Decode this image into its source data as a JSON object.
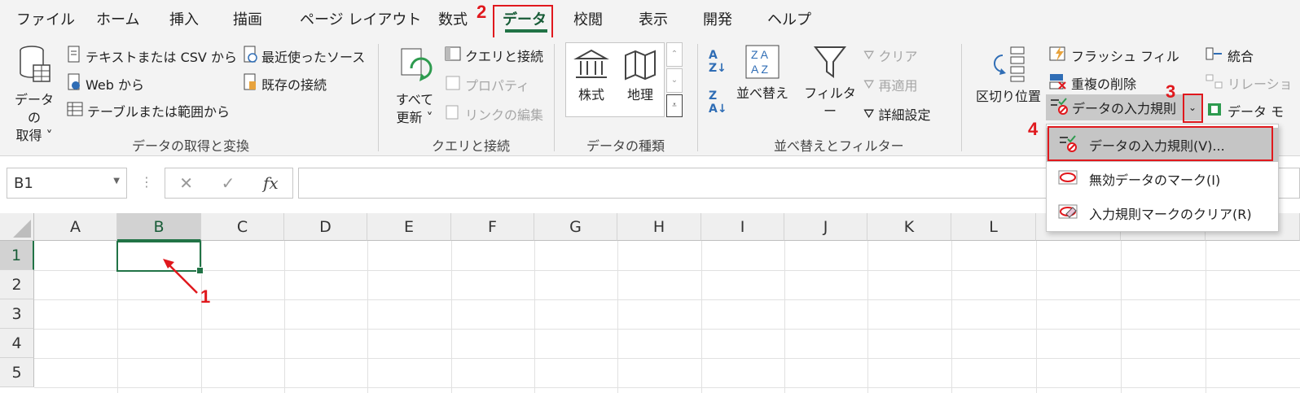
{
  "tabs": [
    {
      "label": "ファイル"
    },
    {
      "label": "ホーム"
    },
    {
      "label": "挿入"
    },
    {
      "label": "描画"
    },
    {
      "label": "ページ レイアウト"
    },
    {
      "label": "数式"
    },
    {
      "label": "データ"
    },
    {
      "label": "校閲"
    },
    {
      "label": "表示"
    },
    {
      "label": "開発"
    },
    {
      "label": "ヘルプ"
    }
  ],
  "ribbon": {
    "get_data": {
      "big_line1": "データの",
      "big_line2": "取得 ˅",
      "text_csv": "テキストまたは CSV から",
      "web": "Web から",
      "table_range": "テーブルまたは範囲から",
      "recent": "最近使ったソース",
      "existing": "既存の接続",
      "label": "データの取得と変換"
    },
    "queries": {
      "refresh_line1": "すべて",
      "refresh_line2": "更新 ˅",
      "queries_conn": "クエリと接続",
      "properties": "プロパティ",
      "edit_links": "リンクの編集",
      "label": "クエリと接続"
    },
    "data_types": {
      "stocks": "株式",
      "geography": "地理",
      "label": "データの種類"
    },
    "sort_filter": {
      "sort": "並べ替え",
      "filter": "フィルター",
      "clear": "クリア",
      "reapply": "再適用",
      "advanced": "詳細設定",
      "label": "並べ替えとフィルター"
    },
    "data_tools": {
      "text_to_columns": "区切り位置",
      "flash_fill": "フラッシュ フィル",
      "remove_dup": "重複の削除",
      "validation": "データの入力規則",
      "consolidate": "統合",
      "relationships": "リレーショ",
      "data_model": "データ モ"
    }
  },
  "dropdown": {
    "items": [
      {
        "label": "データの入力規則(V)..."
      },
      {
        "label": "無効データのマーク(I)"
      },
      {
        "label": "入力規則マークのクリア(R)"
      }
    ]
  },
  "formula_bar": {
    "name_box": "B1",
    "cancel": "✕",
    "enter": "✓",
    "fx": "fx",
    "value": ""
  },
  "columns": [
    "A",
    "B",
    "C",
    "D",
    "E",
    "F",
    "G",
    "H",
    "I",
    "J",
    "K",
    "L"
  ],
  "rows": [
    "1",
    "2",
    "3",
    "4",
    "5"
  ],
  "steps": [
    "1",
    "2",
    "3",
    "4"
  ],
  "colors": {
    "accent": "#217346",
    "highlight": "#e0181d"
  }
}
